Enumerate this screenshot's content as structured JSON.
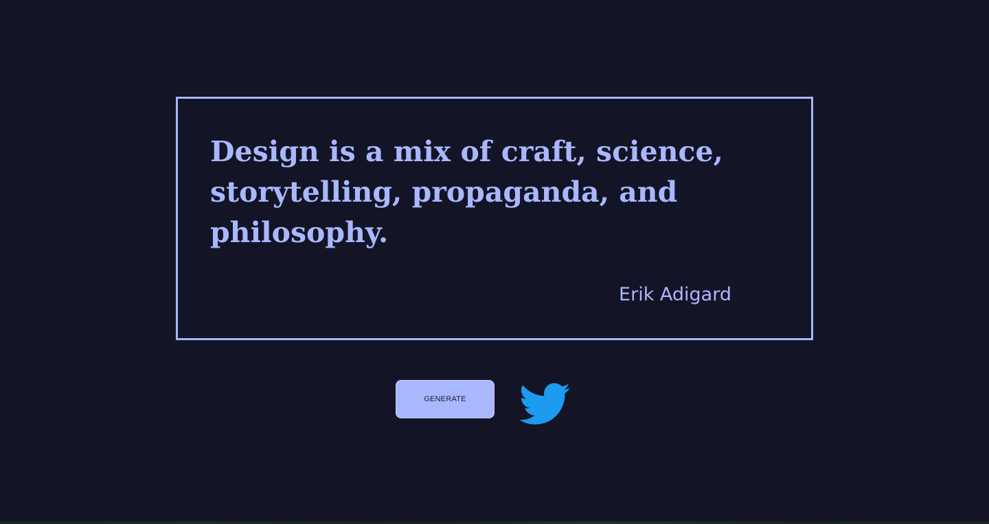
{
  "quote": {
    "text": "Design is a mix of craft, science, storytelling, propaganda, and philosophy.",
    "author": "Erik Adigard"
  },
  "actions": {
    "generate_label": "GENERATE",
    "twitter_icon": "twitter-bird-icon"
  },
  "colors": {
    "background": "#131426",
    "accent": "#a9b7ff",
    "twitter": "#1d9bf0"
  }
}
